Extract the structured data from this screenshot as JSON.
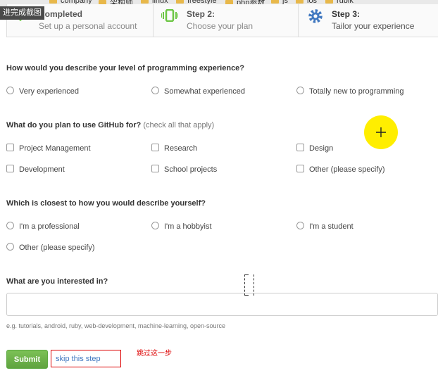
{
  "bookmarks": [
    "company",
    "架构师",
    "linux",
    "freestyle",
    "php参数",
    "js",
    "ios",
    "rubik"
  ],
  "overlay_text": "进完成截图",
  "steps": [
    {
      "title": "Completed",
      "sub": "Set up a personal account"
    },
    {
      "title": "Step 2:",
      "sub": "Choose your plan"
    },
    {
      "title": "Step 3:",
      "sub": "Tailor your experience"
    }
  ],
  "q1": {
    "label": "How would you describe your level of programming experience?",
    "options": [
      "Very experienced",
      "Somewhat experienced",
      "Totally new to programming"
    ]
  },
  "q2": {
    "label": "What do you plan to use GitHub for?",
    "hint": "(check all that apply)",
    "options": [
      "Project Management",
      "Research",
      "Design",
      "Development",
      "School projects",
      "Other (please specify)"
    ]
  },
  "q3": {
    "label": "Which is closest to how you would describe yourself?",
    "options": [
      "I'm a professional",
      "I'm a hobbyist",
      "I'm a student",
      "Other (please specify)"
    ]
  },
  "q4": {
    "label": "What are you interested in?",
    "helper": "e.g. tutorials, android, ruby, web-development, machine-learning, open-source",
    "value": ""
  },
  "actions": {
    "submit": "Submit",
    "skip": "skip this step",
    "annotation": "跳过这一步"
  },
  "colors": {
    "submit_green": "#6cb34a",
    "link_blue": "#4078c0",
    "annotation_red": "#dd0000",
    "cursor_highlight": "#ffee00"
  }
}
